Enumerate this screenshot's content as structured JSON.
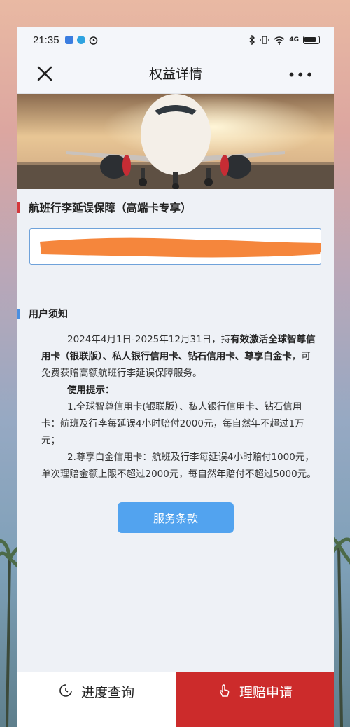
{
  "status_bar": {
    "time": "21:35",
    "icons": [
      "app-badge-icon",
      "chat-badge-icon",
      "alarm-icon",
      "bluetooth-icon",
      "vibrate-icon",
      "wifi-icon",
      "signal-4g-icon",
      "battery-icon"
    ],
    "network_label": "4G"
  },
  "nav": {
    "title": "权益详情",
    "more": "•••"
  },
  "hero": {
    "image_desc_icon": "airplane-hero-image"
  },
  "section": {
    "title": "航班行李延误保障（高端卡专享）",
    "input_value": ""
  },
  "notes": {
    "title": "用户须知",
    "p1_a": "2024年4月1日-2025年12月31日，持",
    "p1_b": "有效激活全球智尊信用卡（银联版）、私人银行信用卡、钻石信用卡、尊享白金卡",
    "p1_c": "，可免费获赠高额航班行李延误保障服务。",
    "tip_title": "使用提示：",
    "tip1": "1.全球智尊信用卡(银联版）、私人银行信用卡、钻石信用卡：航班及行李每延误4小时赔付2000元，每自然年不超过1万元；",
    "tip2": "2.尊享白金信用卡：航班及行李每延误4小时赔付1000元，单次理赔金额上限不超过2000元，每自然年赔付不超过5000元。"
  },
  "terms_button": "服务条款",
  "bottom": {
    "query_label": "进度查询",
    "claim_label": "理赔申请"
  },
  "colors": {
    "accent_blue": "#52a3ef",
    "claim_red": "#cc2b2b",
    "section_bar_red": "#d4383c",
    "notes_bar_blue": "#4a8fe0",
    "redaction_orange": "#f5863c"
  }
}
